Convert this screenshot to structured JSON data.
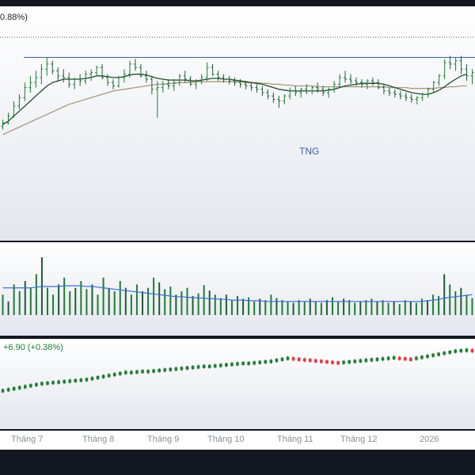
{
  "header": {
    "change_text": "0.88%)"
  },
  "chart_data": [
    {
      "type": "candlestick",
      "name": "main-price",
      "annotation": "TNG",
      "price_scale": [
        0,
        100
      ],
      "ohlc": [
        {
          "o": 10,
          "h": 18,
          "l": 6,
          "c": 14
        },
        {
          "o": 14,
          "h": 26,
          "l": 12,
          "c": 22
        },
        {
          "o": 22,
          "h": 40,
          "l": 20,
          "c": 34
        },
        {
          "o": 34,
          "h": 48,
          "l": 30,
          "c": 44
        },
        {
          "o": 44,
          "h": 62,
          "l": 40,
          "c": 56
        },
        {
          "o": 56,
          "h": 70,
          "l": 50,
          "c": 62
        },
        {
          "o": 62,
          "h": 76,
          "l": 56,
          "c": 68
        },
        {
          "o": 68,
          "h": 84,
          "l": 60,
          "c": 78
        },
        {
          "o": 78,
          "h": 92,
          "l": 70,
          "c": 84
        },
        {
          "o": 84,
          "h": 88,
          "l": 72,
          "c": 76
        },
        {
          "o": 76,
          "h": 80,
          "l": 64,
          "c": 70
        },
        {
          "o": 70,
          "h": 78,
          "l": 62,
          "c": 68
        },
        {
          "o": 68,
          "h": 74,
          "l": 56,
          "c": 60
        },
        {
          "o": 60,
          "h": 68,
          "l": 54,
          "c": 66
        },
        {
          "o": 66,
          "h": 72,
          "l": 58,
          "c": 64
        },
        {
          "o": 64,
          "h": 76,
          "l": 60,
          "c": 72
        },
        {
          "o": 72,
          "h": 78,
          "l": 64,
          "c": 74
        },
        {
          "o": 74,
          "h": 82,
          "l": 70,
          "c": 80
        },
        {
          "o": 80,
          "h": 84,
          "l": 66,
          "c": 68
        },
        {
          "o": 68,
          "h": 72,
          "l": 58,
          "c": 62
        },
        {
          "o": 62,
          "h": 66,
          "l": 54,
          "c": 58
        },
        {
          "o": 58,
          "h": 70,
          "l": 56,
          "c": 68
        },
        {
          "o": 68,
          "h": 78,
          "l": 62,
          "c": 72
        },
        {
          "o": 72,
          "h": 88,
          "l": 68,
          "c": 84
        },
        {
          "o": 84,
          "h": 90,
          "l": 76,
          "c": 80
        },
        {
          "o": 80,
          "h": 84,
          "l": 68,
          "c": 70
        },
        {
          "o": 70,
          "h": 76,
          "l": 62,
          "c": 66
        },
        {
          "o": 66,
          "h": 70,
          "l": 48,
          "c": 54
        },
        {
          "o": 54,
          "h": 64,
          "l": 20,
          "c": 56
        },
        {
          "o": 56,
          "h": 64,
          "l": 50,
          "c": 60
        },
        {
          "o": 60,
          "h": 66,
          "l": 54,
          "c": 58
        },
        {
          "o": 58,
          "h": 66,
          "l": 52,
          "c": 62
        },
        {
          "o": 62,
          "h": 72,
          "l": 58,
          "c": 70
        },
        {
          "o": 70,
          "h": 76,
          "l": 62,
          "c": 66
        },
        {
          "o": 66,
          "h": 70,
          "l": 58,
          "c": 60
        },
        {
          "o": 60,
          "h": 66,
          "l": 54,
          "c": 64
        },
        {
          "o": 64,
          "h": 72,
          "l": 60,
          "c": 68
        },
        {
          "o": 68,
          "h": 86,
          "l": 64,
          "c": 80
        },
        {
          "o": 80,
          "h": 84,
          "l": 70,
          "c": 72
        },
        {
          "o": 72,
          "h": 76,
          "l": 64,
          "c": 68
        },
        {
          "o": 68,
          "h": 72,
          "l": 62,
          "c": 66
        },
        {
          "o": 66,
          "h": 70,
          "l": 60,
          "c": 64
        },
        {
          "o": 64,
          "h": 68,
          "l": 58,
          "c": 62
        },
        {
          "o": 62,
          "h": 66,
          "l": 56,
          "c": 60
        },
        {
          "o": 60,
          "h": 64,
          "l": 54,
          "c": 58
        },
        {
          "o": 58,
          "h": 62,
          "l": 52,
          "c": 56
        },
        {
          "o": 56,
          "h": 60,
          "l": 50,
          "c": 54
        },
        {
          "o": 54,
          "h": 58,
          "l": 46,
          "c": 50
        },
        {
          "o": 50,
          "h": 54,
          "l": 42,
          "c": 46
        },
        {
          "o": 46,
          "h": 50,
          "l": 38,
          "c": 42
        },
        {
          "o": 42,
          "h": 46,
          "l": 32,
          "c": 40
        },
        {
          "o": 40,
          "h": 48,
          "l": 36,
          "c": 46
        },
        {
          "o": 46,
          "h": 56,
          "l": 42,
          "c": 52
        },
        {
          "o": 52,
          "h": 58,
          "l": 46,
          "c": 50
        },
        {
          "o": 50,
          "h": 56,
          "l": 44,
          "c": 54
        },
        {
          "o": 54,
          "h": 60,
          "l": 48,
          "c": 52
        },
        {
          "o": 52,
          "h": 58,
          "l": 48,
          "c": 56
        },
        {
          "o": 56,
          "h": 62,
          "l": 50,
          "c": 54
        },
        {
          "o": 54,
          "h": 58,
          "l": 46,
          "c": 50
        },
        {
          "o": 50,
          "h": 56,
          "l": 44,
          "c": 54
        },
        {
          "o": 54,
          "h": 64,
          "l": 50,
          "c": 60
        },
        {
          "o": 60,
          "h": 72,
          "l": 56,
          "c": 68
        },
        {
          "o": 68,
          "h": 76,
          "l": 62,
          "c": 66
        },
        {
          "o": 66,
          "h": 72,
          "l": 60,
          "c": 64
        },
        {
          "o": 64,
          "h": 68,
          "l": 58,
          "c": 62
        },
        {
          "o": 62,
          "h": 66,
          "l": 56,
          "c": 60
        },
        {
          "o": 60,
          "h": 66,
          "l": 54,
          "c": 64
        },
        {
          "o": 64,
          "h": 68,
          "l": 58,
          "c": 62
        },
        {
          "o": 62,
          "h": 66,
          "l": 54,
          "c": 56
        },
        {
          "o": 56,
          "h": 60,
          "l": 48,
          "c": 52
        },
        {
          "o": 52,
          "h": 56,
          "l": 46,
          "c": 50
        },
        {
          "o": 50,
          "h": 54,
          "l": 44,
          "c": 48
        },
        {
          "o": 48,
          "h": 52,
          "l": 42,
          "c": 46
        },
        {
          "o": 46,
          "h": 50,
          "l": 40,
          "c": 44
        },
        {
          "o": 44,
          "h": 48,
          "l": 38,
          "c": 42
        },
        {
          "o": 42,
          "h": 46,
          "l": 36,
          "c": 44
        },
        {
          "o": 44,
          "h": 50,
          "l": 40,
          "c": 48
        },
        {
          "o": 48,
          "h": 56,
          "l": 44,
          "c": 54
        },
        {
          "o": 54,
          "h": 64,
          "l": 50,
          "c": 62
        },
        {
          "o": 62,
          "h": 72,
          "l": 58,
          "c": 70
        },
        {
          "o": 70,
          "h": 90,
          "l": 66,
          "c": 86
        },
        {
          "o": 86,
          "h": 94,
          "l": 78,
          "c": 84
        },
        {
          "o": 84,
          "h": 92,
          "l": 76,
          "c": 88
        },
        {
          "o": 88,
          "h": 94,
          "l": 72,
          "c": 78
        },
        {
          "o": 78,
          "h": 84,
          "l": 64,
          "c": 70
        },
        {
          "o": 70,
          "h": 78,
          "l": 60,
          "c": 74
        }
      ],
      "ma_fast": [
        12,
        16,
        22,
        28,
        34,
        40,
        46,
        52,
        58,
        62,
        64,
        66,
        66,
        66,
        66,
        67,
        68,
        70,
        70,
        69,
        68,
        68,
        69,
        71,
        72,
        72,
        71,
        69,
        67,
        66,
        65,
        65,
        65,
        65,
        64,
        64,
        65,
        66,
        67,
        67,
        66,
        66,
        65,
        64,
        63,
        62,
        61,
        60,
        58,
        56,
        54,
        53,
        52,
        52,
        52,
        52,
        52,
        52,
        52,
        53,
        54,
        56,
        58,
        59,
        60,
        61,
        61,
        61,
        61,
        60,
        58,
        56,
        54,
        52,
        50,
        49,
        48,
        48,
        50,
        53,
        57,
        62,
        66,
        70,
        72
      ],
      "ma_slow": [
        0,
        3,
        6,
        9,
        12,
        15,
        18,
        21,
        24,
        27,
        30,
        33,
        36,
        38,
        40,
        42,
        44,
        46,
        48,
        50,
        52,
        53,
        54,
        55,
        56,
        57,
        58,
        59,
        60,
        60,
        61,
        61,
        62,
        62,
        62,
        63,
        63,
        63,
        63,
        63,
        63,
        63,
        63,
        63,
        62,
        62,
        62,
        61,
        61,
        60,
        60,
        59,
        59,
        58,
        58,
        58,
        58,
        57,
        57,
        57,
        57,
        57,
        57,
        57,
        57,
        57,
        57,
        57,
        57,
        57,
        56,
        56,
        56,
        56,
        55,
        55,
        55,
        55,
        55,
        56,
        56,
        57,
        57,
        58,
        58
      ],
      "resistance_level": 92
    },
    {
      "type": "bar",
      "name": "volume",
      "values": [
        30,
        20,
        45,
        35,
        50,
        40,
        60,
        85,
        40,
        30,
        45,
        55,
        35,
        40,
        50,
        38,
        45,
        30,
        55,
        40,
        35,
        50,
        40,
        30,
        45,
        35,
        40,
        55,
        48,
        38,
        42,
        30,
        35,
        40,
        28,
        32,
        44,
        36,
        30,
        25,
        30,
        22,
        28,
        24,
        26,
        20,
        24,
        22,
        30,
        25,
        22,
        20,
        18,
        22,
        20,
        24,
        20,
        18,
        22,
        26,
        20,
        24,
        22,
        18,
        20,
        22,
        24,
        20,
        22,
        18,
        20,
        16,
        22,
        20,
        18,
        24,
        22,
        30,
        28,
        60,
        45,
        35,
        40,
        30,
        25
      ],
      "ma_line": [
        40,
        40,
        40,
        40,
        40,
        40,
        41,
        42,
        42,
        42,
        42,
        43,
        43,
        43,
        43,
        42,
        42,
        41,
        40,
        39,
        38,
        37,
        36,
        35,
        34,
        33,
        32,
        31,
        30,
        29,
        28,
        27,
        27,
        26,
        26,
        25,
        25,
        24,
        24,
        23,
        23,
        22,
        22,
        22,
        21,
        21,
        21,
        20,
        20,
        20,
        20,
        20,
        20,
        20,
        20,
        20,
        20,
        20,
        20,
        20,
        20,
        20,
        20,
        20,
        20,
        20,
        20,
        20,
        20,
        20,
        20,
        20,
        20,
        20,
        20,
        20,
        21,
        22,
        23,
        25,
        26,
        27,
        28,
        29,
        30
      ],
      "ylim": [
        0,
        100
      ]
    },
    {
      "type": "candlestick",
      "name": "index",
      "label": "+6.90 (+0.38%)",
      "values": [
        10,
        12,
        14,
        16,
        18,
        20,
        22,
        24,
        25,
        26,
        27,
        28,
        29,
        30,
        31,
        32,
        34,
        36,
        38,
        40,
        42,
        44,
        46,
        46,
        47,
        48,
        48,
        49,
        50,
        51,
        52,
        53,
        54,
        55,
        56,
        57,
        58,
        58,
        59,
        60,
        61,
        62,
        63,
        64,
        64,
        65,
        66,
        67,
        68,
        70,
        72,
        74,
        73,
        72,
        71,
        70,
        69,
        68,
        67,
        66,
        65,
        66,
        67,
        68,
        69,
        70,
        71,
        72,
        73,
        74,
        75,
        74,
        73,
        72,
        74,
        76,
        78,
        80,
        82,
        84,
        86,
        88,
        89,
        90,
        89
      ],
      "ylim": [
        0,
        100
      ]
    }
  ],
  "time_axis": {
    "ticks": [
      "Tháng 7",
      "Tháng 8",
      "Tháng 9",
      "Tháng 10",
      "Tháng 11",
      "Tháng 12",
      "2026"
    ]
  },
  "colors": {
    "up": "#1e7d34",
    "down": "#e5363a",
    "ma_fast": "#1e4d2b",
    "ma_slow": "#a89a7a",
    "ma_dotted": "#8a8d99",
    "resistance": "#3b5fa8",
    "volume_ma": "#3b6fd8",
    "annotation": "#3b5fa8"
  }
}
